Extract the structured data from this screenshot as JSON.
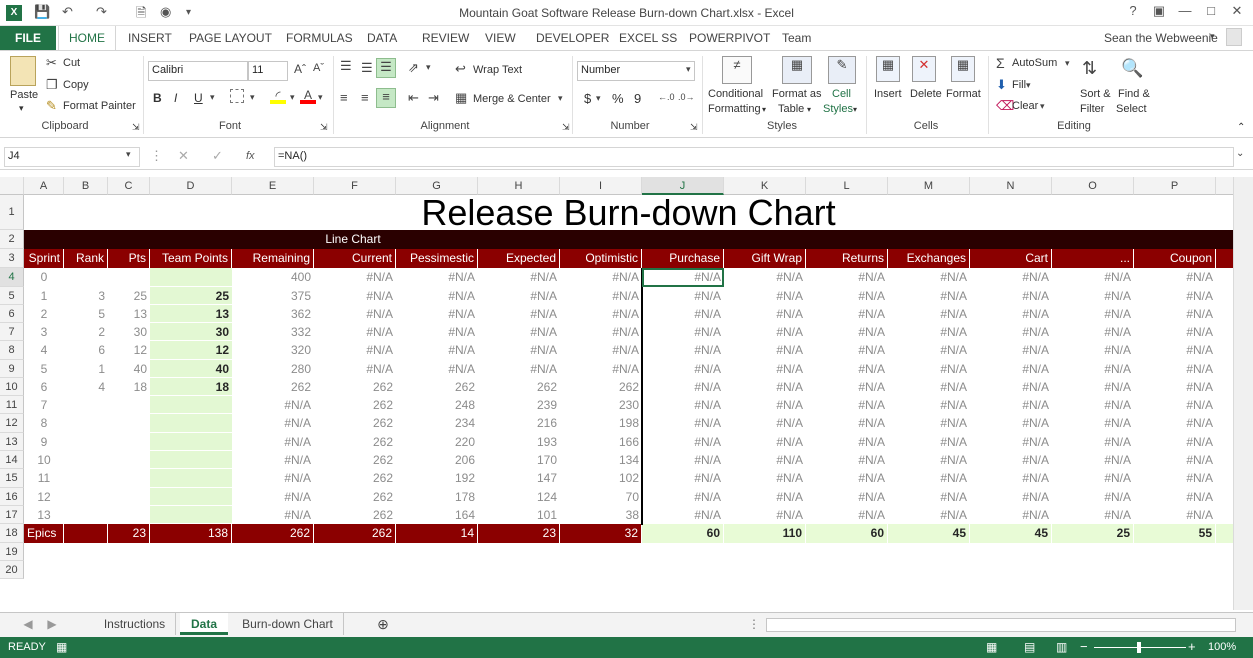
{
  "window": {
    "title": "Mountain Goat Software Release Burn-down Chart.xlsx - Excel",
    "user": "Sean the Webweenie"
  },
  "menu": {
    "file": "FILE",
    "tabs": [
      "HOME",
      "INSERT",
      "PAGE LAYOUT",
      "FORMULAS",
      "DATA",
      "REVIEW",
      "VIEW",
      "DEVELOPER",
      "EXCEL SS",
      "POWERPIVOT",
      "Team"
    ]
  },
  "ribbon": {
    "clipboard": {
      "paste": "Paste",
      "cut": "Cut",
      "copy": "Copy",
      "format_painter": "Format Painter",
      "group": "Clipboard"
    },
    "font": {
      "name": "Calibri",
      "size": "11",
      "group": "Font",
      "bold": "B",
      "italic": "I",
      "underline": "U"
    },
    "alignment": {
      "wrap": "Wrap Text",
      "merge": "Merge & Center",
      "group": "Alignment"
    },
    "number": {
      "format": "Number",
      "currency": "$",
      "percent": "%",
      "comma": "9",
      "group": "Number"
    },
    "styles": {
      "conditional": "Conditional",
      "conditional2": "Formatting",
      "format_as": "Format as",
      "table": "Table",
      "cell": "Cell",
      "cell_styles": "Styles",
      "group": "Styles"
    },
    "cells": {
      "insert": "Insert",
      "delete": "Delete",
      "format": "Format",
      "group": "Cells"
    },
    "editing": {
      "autosum": "AutoSum",
      "fill": "Fill",
      "clear": "Clear",
      "sort": "Sort &",
      "filter": "Filter",
      "find": "Find &",
      "select": "Select",
      "group": "Editing"
    }
  },
  "formula_bar": {
    "name_box": "J4",
    "fx": "fx",
    "formula": "=NA()"
  },
  "columns": [
    "A",
    "B",
    "C",
    "D",
    "E",
    "F",
    "G",
    "H",
    "I",
    "J",
    "K",
    "L",
    "M",
    "N",
    "O",
    "P"
  ],
  "rows": [
    "1",
    "2",
    "3",
    "4",
    "5",
    "6",
    "7",
    "8",
    "9",
    "10",
    "11",
    "12",
    "13",
    "14",
    "15",
    "16",
    "17",
    "18",
    "19",
    "20"
  ],
  "sheet": {
    "title": "Release Burn-down Chart",
    "line_chart_label": "Line Chart",
    "headers": [
      "Sprint",
      "Rank",
      "Pts",
      "Team Points",
      "Remaining",
      "Current",
      "Pessimestic",
      "Expected",
      "Optimistic",
      "Purchase",
      "Gift Wrap",
      "Returns",
      "Exchanges",
      "Cart",
      "...",
      "Coupon"
    ],
    "data_rows": [
      [
        "0",
        "",
        "",
        "",
        "400",
        "#N/A",
        "#N/A",
        "#N/A",
        "#N/A",
        "#N/A",
        "#N/A",
        "#N/A",
        "#N/A",
        "#N/A",
        "#N/A",
        "#N/A"
      ],
      [
        "1",
        "3",
        "25",
        "25",
        "375",
        "#N/A",
        "#N/A",
        "#N/A",
        "#N/A",
        "#N/A",
        "#N/A",
        "#N/A",
        "#N/A",
        "#N/A",
        "#N/A",
        "#N/A"
      ],
      [
        "2",
        "5",
        "13",
        "13",
        "362",
        "#N/A",
        "#N/A",
        "#N/A",
        "#N/A",
        "#N/A",
        "#N/A",
        "#N/A",
        "#N/A",
        "#N/A",
        "#N/A",
        "#N/A"
      ],
      [
        "3",
        "2",
        "30",
        "30",
        "332",
        "#N/A",
        "#N/A",
        "#N/A",
        "#N/A",
        "#N/A",
        "#N/A",
        "#N/A",
        "#N/A",
        "#N/A",
        "#N/A",
        "#N/A"
      ],
      [
        "4",
        "6",
        "12",
        "12",
        "320",
        "#N/A",
        "#N/A",
        "#N/A",
        "#N/A",
        "#N/A",
        "#N/A",
        "#N/A",
        "#N/A",
        "#N/A",
        "#N/A",
        "#N/A"
      ],
      [
        "5",
        "1",
        "40",
        "40",
        "280",
        "#N/A",
        "#N/A",
        "#N/A",
        "#N/A",
        "#N/A",
        "#N/A",
        "#N/A",
        "#N/A",
        "#N/A",
        "#N/A",
        "#N/A"
      ],
      [
        "6",
        "4",
        "18",
        "18",
        "262",
        "262",
        "262",
        "262",
        "262",
        "#N/A",
        "#N/A",
        "#N/A",
        "#N/A",
        "#N/A",
        "#N/A",
        "#N/A"
      ],
      [
        "7",
        "",
        "",
        "",
        "#N/A",
        "262",
        "248",
        "239",
        "230",
        "#N/A",
        "#N/A",
        "#N/A",
        "#N/A",
        "#N/A",
        "#N/A",
        "#N/A"
      ],
      [
        "8",
        "",
        "",
        "",
        "#N/A",
        "262",
        "234",
        "216",
        "198",
        "#N/A",
        "#N/A",
        "#N/A",
        "#N/A",
        "#N/A",
        "#N/A",
        "#N/A"
      ],
      [
        "9",
        "",
        "",
        "",
        "#N/A",
        "262",
        "220",
        "193",
        "166",
        "#N/A",
        "#N/A",
        "#N/A",
        "#N/A",
        "#N/A",
        "#N/A",
        "#N/A"
      ],
      [
        "10",
        "",
        "",
        "",
        "#N/A",
        "262",
        "206",
        "170",
        "134",
        "#N/A",
        "#N/A",
        "#N/A",
        "#N/A",
        "#N/A",
        "#N/A",
        "#N/A"
      ],
      [
        "11",
        "",
        "",
        "",
        "#N/A",
        "262",
        "192",
        "147",
        "102",
        "#N/A",
        "#N/A",
        "#N/A",
        "#N/A",
        "#N/A",
        "#N/A",
        "#N/A"
      ],
      [
        "12",
        "",
        "",
        "",
        "#N/A",
        "262",
        "178",
        "124",
        "70",
        "#N/A",
        "#N/A",
        "#N/A",
        "#N/A",
        "#N/A",
        "#N/A",
        "#N/A"
      ],
      [
        "13",
        "",
        "",
        "",
        "#N/A",
        "262",
        "164",
        "101",
        "38",
        "#N/A",
        "#N/A",
        "#N/A",
        "#N/A",
        "#N/A",
        "#N/A",
        "#N/A"
      ]
    ],
    "totals": [
      "Epics",
      "",
      "23",
      "138",
      "262",
      "262",
      "14",
      "23",
      "32",
      "60",
      "110",
      "60",
      "45",
      "45",
      "25",
      "55"
    ]
  },
  "sheet_tabs": [
    "Instructions",
    "Data",
    "Burn-down Chart"
  ],
  "active_tab": "Data",
  "status": {
    "ready": "READY",
    "zoom": "100%"
  },
  "colors": {
    "accent": "#217346",
    "header_red": "#8b0000",
    "green_cell": "#e3f8d3"
  }
}
